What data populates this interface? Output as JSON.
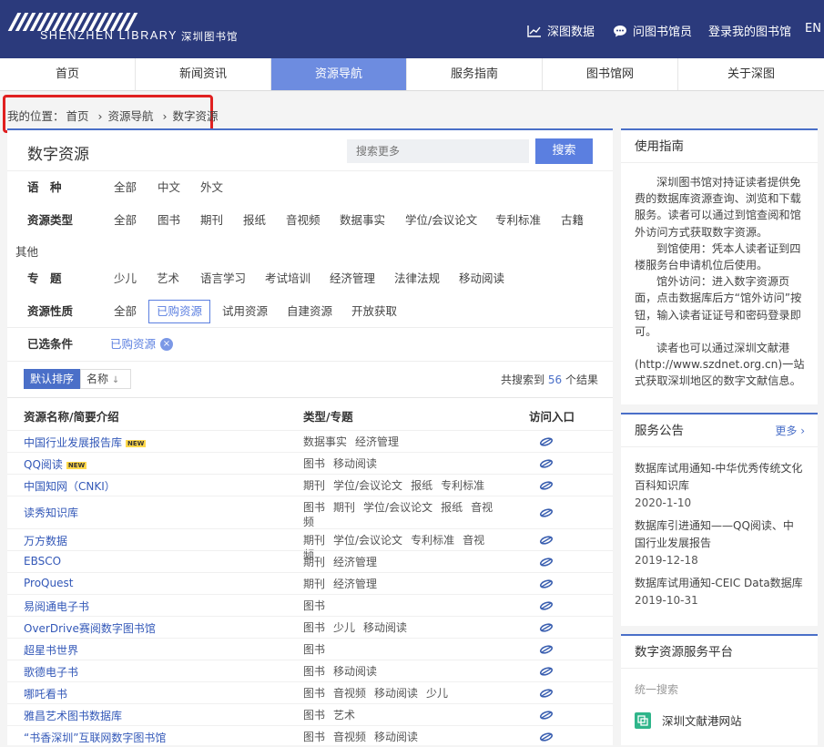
{
  "header": {
    "logo_en": "SHENZHEN LIBRARY",
    "logo_cn": "深圳图书馆",
    "links": [
      {
        "label": "深图数据",
        "icon": "chart-line-icon"
      },
      {
        "label": "问图书馆员",
        "icon": "chat-bubble-icon"
      },
      {
        "label": "登录我的图书馆",
        "icon": ""
      },
      {
        "label": "EN",
        "icon": ""
      }
    ],
    "bg_color": "#2b3a7c"
  },
  "nav": [
    "首页",
    "新闻资讯",
    "资源导航",
    "服务指南",
    "图书馆网",
    "关于深图"
  ],
  "nav_active": "资源导航",
  "breadcrumb": {
    "prefix": "我的位置：",
    "items": [
      "首页",
      "资源导航",
      "数字资源"
    ],
    "separator": "›"
  },
  "main": {
    "title": "数字资源",
    "search_placeholder": "搜索更多",
    "search_button": "搜索",
    "filters": {
      "language": {
        "label": "语　种",
        "options": [
          "全部",
          "中文",
          "外文"
        ]
      },
      "type": {
        "label": "资源类型",
        "options": [
          "全部",
          "图书",
          "期刊",
          "报纸",
          "音视频",
          "数据事实",
          "学位/会议论文",
          "专利标准",
          "古籍"
        ],
        "overflow": "其他"
      },
      "topic": {
        "label": "专　题",
        "options": [
          "少儿",
          "艺术",
          "语言学习",
          "考试培训",
          "经济管理",
          "法律法规",
          "移动阅读"
        ]
      },
      "nature": {
        "label": "资源性质",
        "options": [
          "全部",
          "已购资源",
          "试用资源",
          "自建资源",
          "开放获取"
        ],
        "selected": "已购资源"
      }
    },
    "selected_conditions": {
      "label": "已选条件",
      "chip": "已购资源",
      "chip_remove": "×"
    },
    "sort": {
      "default": "默认排序",
      "name": "名称",
      "arrow": "↓"
    },
    "total": {
      "prefix": "共搜索到",
      "count": "56",
      "suffix": "个结果"
    },
    "table_headers": [
      "资源名称/简要介绍",
      "类型/专题",
      "访问入口"
    ],
    "rows": [
      {
        "name": "中国行业发展报告库",
        "new": true,
        "types": [
          "数据事实",
          "经济管理"
        ]
      },
      {
        "name": "QQ阅读",
        "new": true,
        "types": [
          "图书",
          "移动阅读"
        ]
      },
      {
        "name": "中国知网（CNKI）",
        "new": false,
        "types": [
          "期刊",
          "学位/会议论文",
          "报纸",
          "专利标准"
        ]
      },
      {
        "name": "读秀知识库",
        "new": false,
        "types": [
          "图书",
          "期刊",
          "学位/会议论文",
          "报纸",
          "音视频"
        ]
      },
      {
        "name": "万方数据",
        "new": false,
        "types": [
          "期刊",
          "学位/会议论文",
          "专利标准",
          "音视频"
        ]
      },
      {
        "name": "EBSCO",
        "new": false,
        "types": [
          "期刊",
          "经济管理"
        ]
      },
      {
        "name": "ProQuest",
        "new": false,
        "types": [
          "期刊",
          "经济管理"
        ]
      },
      {
        "name": "易阅通电子书",
        "new": false,
        "types": [
          "图书"
        ]
      },
      {
        "name": "OverDrive赛阅数字图书馆",
        "new": false,
        "types": [
          "图书",
          "少儿",
          "移动阅读"
        ]
      },
      {
        "name": "超星书世界",
        "new": false,
        "types": [
          "图书"
        ]
      },
      {
        "name": "歌德电子书",
        "new": false,
        "types": [
          "图书",
          "移动阅读"
        ]
      },
      {
        "name": "哪吒看书",
        "new": false,
        "types": [
          "图书",
          "音视频",
          "移动阅读",
          "少儿"
        ]
      },
      {
        "name": "雅昌艺术图书数据库",
        "new": false,
        "types": [
          "图书",
          "艺术"
        ]
      },
      {
        "name": "“书香深圳”互联网数字图书馆",
        "new": false,
        "types": [
          "图书",
          "音视频",
          "移动阅读"
        ]
      }
    ],
    "new_badge": "NEW"
  },
  "sidebar": {
    "guide_title": "使用指南",
    "guide_paragraphs": [
      "深圳图书馆对持证读者提供免费的数据库资源查询、浏览和下载服务。读者可以通过到馆查阅和馆外访问方式获取数字资源。",
      "到馆使用：凭本人读者证到四楼服务台申请机位后使用。",
      "馆外访问：进入数字资源页面，点击数据库后方“馆外访问”按钮，输入读者证证号和密码登录即可。",
      "读者也可以通过深圳文献港(http://www.szdnet.org.cn)一站式获取深圳地区的数字文献信息。"
    ],
    "notice_title": "服务公告",
    "notice_more": "更多 ›",
    "notices": [
      {
        "title": "数据库试用通知-中华优秀传统文化百科知识库",
        "date": "2020-1-10"
      },
      {
        "title": "数据库引进通知——QQ阅读、中国行业发展报告",
        "date": "2019-12-18"
      },
      {
        "title": "数据库试用通知-CEIC Data数据库",
        "date": "2019-10-31"
      }
    ],
    "platform_title": "数字资源服务平台",
    "platform_sub": "统一搜索",
    "platform_link": "深圳文献港网站"
  }
}
